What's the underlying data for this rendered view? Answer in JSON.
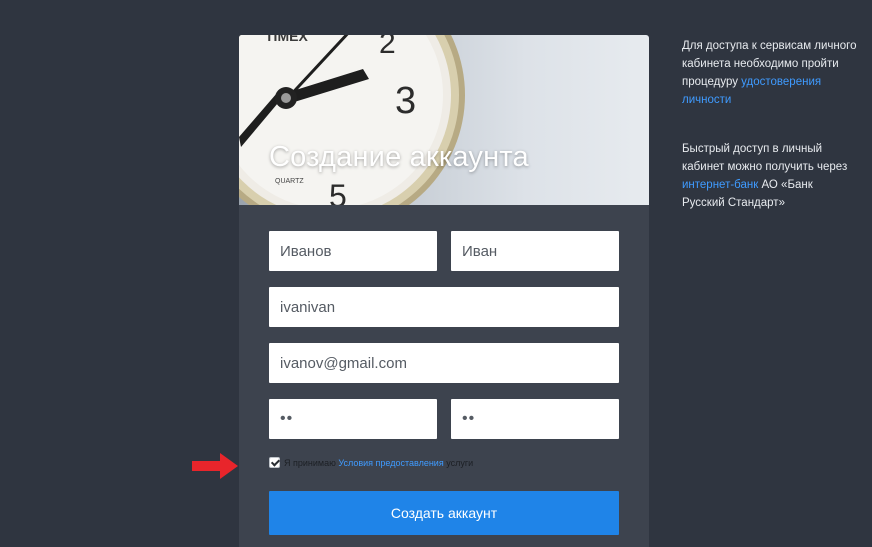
{
  "hero": {
    "title": "Создание аккаунта"
  },
  "form": {
    "last_name": "Иванов",
    "first_name": "Иван",
    "login": "ivanivan",
    "email": "ivanov@gmail.com",
    "password": "••",
    "password_confirm": "••",
    "agree_prefix": "Я принимаю",
    "agree_link": "Условия предоставления",
    "agree_suffix": "услуги",
    "agree_checked": true,
    "submit_label": "Создать аккаунт"
  },
  "sidebar": {
    "para1_text": "Для доступа к сервисам личного кабинета необходимо пройти процедуру",
    "para1_link": "удостоверения личности",
    "para2_prefix": "Быстрый доступ в личный кабинет можно получить через",
    "para2_link": "интернет-банк",
    "para2_suffix": "АО «Банк Русский Стандарт»"
  },
  "colors": {
    "page_bg": "#2f3540",
    "card_bg": "#3d434e",
    "accent": "#1f84e8",
    "link": "#3f9bff",
    "arrow": "#e8252b"
  }
}
